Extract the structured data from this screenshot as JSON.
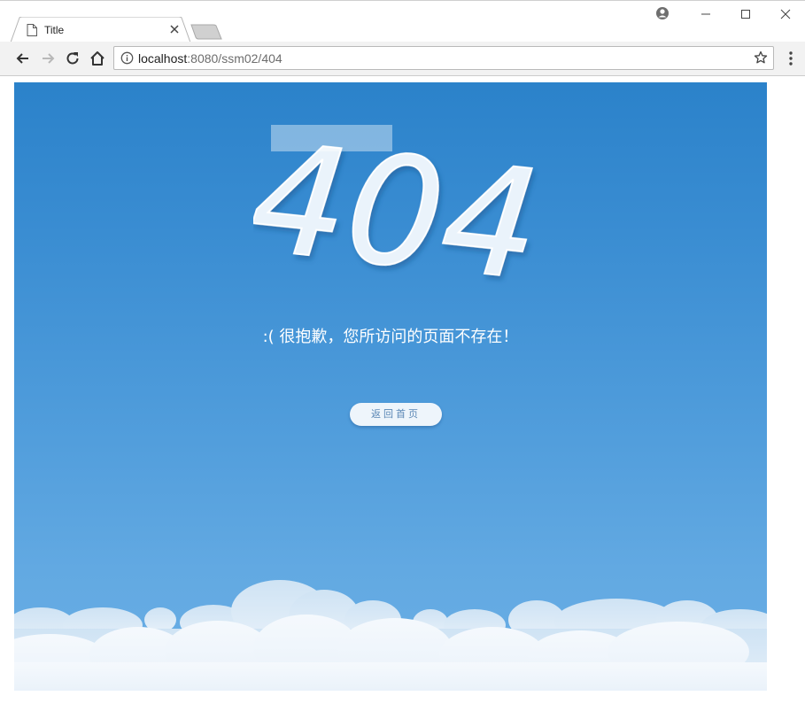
{
  "browser": {
    "tab_title": "Title",
    "url_host": "localhost",
    "url_path": ":8080/ssm02/404"
  },
  "page": {
    "error_code": "404",
    "message": ":(  很抱歉，您所访问的页面不存在！",
    "home_button_label": "返回首页"
  },
  "icons": {
    "tab": "document-icon",
    "close": "close-icon",
    "back": "back-arrow-icon",
    "forward": "forward-arrow-icon",
    "reload": "reload-icon",
    "home": "home-icon",
    "site_info": "info-icon",
    "bookmark": "star-icon",
    "menu": "more-vert-icon",
    "profile": "profile-icon"
  },
  "colors": {
    "sky_top": "#2b82ca",
    "sky_bottom": "#6aaee5",
    "button_text": "#5a87b5"
  }
}
